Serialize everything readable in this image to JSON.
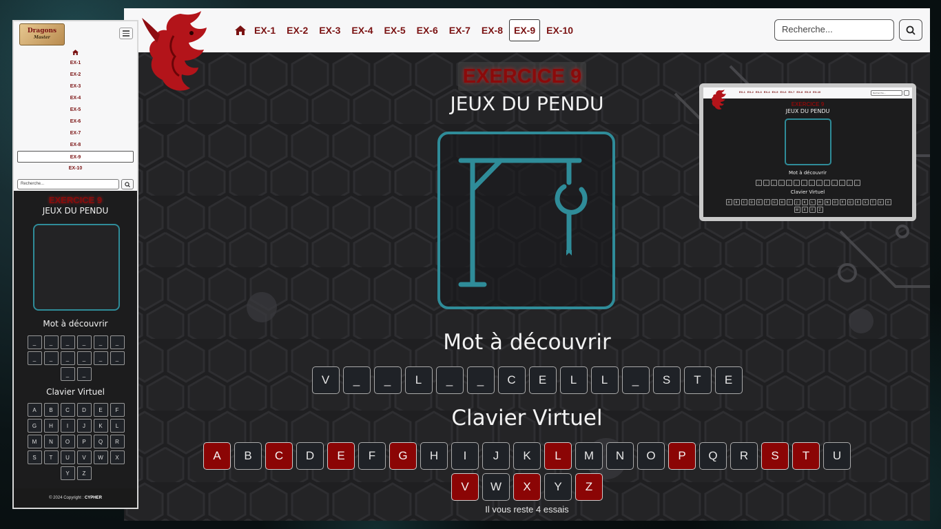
{
  "nav": {
    "items": [
      "EX-1",
      "EX-2",
      "EX-3",
      "EX-4",
      "EX-5",
      "EX-6",
      "EX-7",
      "EX-8",
      "EX-9",
      "EX-10"
    ],
    "active": "EX-9"
  },
  "search": {
    "placeholder": "Recherche..."
  },
  "exercise": {
    "title": "EXERCICE 9",
    "subtitle": "JEUX DU PENDU"
  },
  "word_section": {
    "title": "Mot à découvrir",
    "letters": [
      "V",
      "_",
      "_",
      "L",
      "_",
      "_",
      "C",
      "E",
      "L",
      "L",
      "_",
      "S",
      "T",
      "E"
    ]
  },
  "keyboard": {
    "title": "Clavier Virtuel",
    "keys": [
      {
        "letter": "A",
        "used": true
      },
      {
        "letter": "B",
        "used": false
      },
      {
        "letter": "C",
        "used": true
      },
      {
        "letter": "D",
        "used": false
      },
      {
        "letter": "E",
        "used": true
      },
      {
        "letter": "F",
        "used": false
      },
      {
        "letter": "G",
        "used": true
      },
      {
        "letter": "H",
        "used": false
      },
      {
        "letter": "I",
        "used": false
      },
      {
        "letter": "J",
        "used": false
      },
      {
        "letter": "K",
        "used": false
      },
      {
        "letter": "L",
        "used": true
      },
      {
        "letter": "M",
        "used": false
      },
      {
        "letter": "N",
        "used": false
      },
      {
        "letter": "O",
        "used": false
      },
      {
        "letter": "P",
        "used": true
      },
      {
        "letter": "Q",
        "used": false
      },
      {
        "letter": "R",
        "used": false
      },
      {
        "letter": "S",
        "used": true
      },
      {
        "letter": "T",
        "used": true
      },
      {
        "letter": "U",
        "used": false
      },
      {
        "letter": "V",
        "used": true
      },
      {
        "letter": "W",
        "used": false
      },
      {
        "letter": "X",
        "used": true
      },
      {
        "letter": "Y",
        "used": false
      },
      {
        "letter": "Z",
        "used": true
      }
    ]
  },
  "status": {
    "remaining": "Il vous reste 4 essais"
  },
  "mobile": {
    "logo_title": "Dragons",
    "logo_sub": "Master",
    "word": [
      "_",
      "_",
      "_",
      "_",
      "_",
      "_",
      "_",
      "_",
      "_",
      "_",
      "_",
      "_",
      "_",
      "_"
    ],
    "keys": [
      "A",
      "B",
      "C",
      "D",
      "E",
      "F",
      "G",
      "H",
      "I",
      "J",
      "K",
      "L",
      "M",
      "N",
      "O",
      "P",
      "Q",
      "R",
      "S",
      "T",
      "U",
      "V",
      "W",
      "X",
      "Y",
      "Z"
    ],
    "footer_text": "© 2024 Copyright : ",
    "footer_brand": "CYPHER"
  },
  "colors": {
    "accent_red": "#8b0505",
    "teal": "#2f8c99",
    "nav_text": "#7a1212"
  }
}
